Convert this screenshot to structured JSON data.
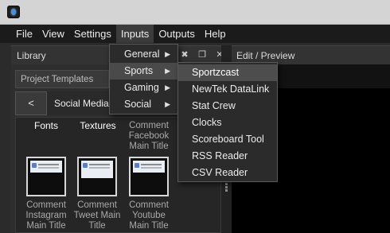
{
  "menubar": {
    "items": [
      "File",
      "View",
      "Settings",
      "Inputs",
      "Outputs",
      "Help"
    ],
    "active_index": 3
  },
  "library": {
    "title": "Library"
  },
  "edit_preview": {
    "title": "Edit / Preview"
  },
  "panel_buttons": {
    "pin": "✖",
    "float": "❐",
    "close": "✕"
  },
  "project_templates": {
    "label": "Project Templates"
  },
  "navigation": {
    "back_label": "<",
    "current_folder": "Social Media"
  },
  "templates": {
    "header_row": [
      {
        "caption": "Fonts"
      },
      {
        "caption": "Textures"
      },
      {
        "caption_lines": [
          "Comment",
          "Facebook",
          "Main Title"
        ]
      }
    ],
    "thumb_row": [
      {
        "caption_lines": [
          "Comment",
          "Instagram",
          "Main Title"
        ]
      },
      {
        "caption_lines": [
          "Comment",
          "Tweet Main",
          "Title"
        ]
      },
      {
        "caption_lines": [
          "Comment",
          "Youtube",
          "Main Title"
        ]
      }
    ]
  },
  "inputs_menu": {
    "items": [
      {
        "label": "General",
        "has_submenu": true
      },
      {
        "label": "Sports",
        "has_submenu": true,
        "highlighted": true
      },
      {
        "label": "Gaming",
        "has_submenu": true
      },
      {
        "label": "Social",
        "has_submenu": true
      }
    ],
    "arrow_glyph": "▶"
  },
  "sports_submenu": {
    "items": [
      {
        "label": "Sportzcast",
        "highlighted": true
      },
      {
        "label": "NewTek DataLink"
      },
      {
        "label": "Stat Crew"
      },
      {
        "label": "Clocks"
      },
      {
        "label": "Scoreboard Tool"
      },
      {
        "label": "RSS Reader"
      },
      {
        "label": "CSV Reader"
      }
    ]
  },
  "colors": {
    "menubar_bg": "#1b1b1b",
    "panel_bg": "#2e2e2e",
    "highlight": "#4a4a4a",
    "preview_bg": "#000000"
  }
}
